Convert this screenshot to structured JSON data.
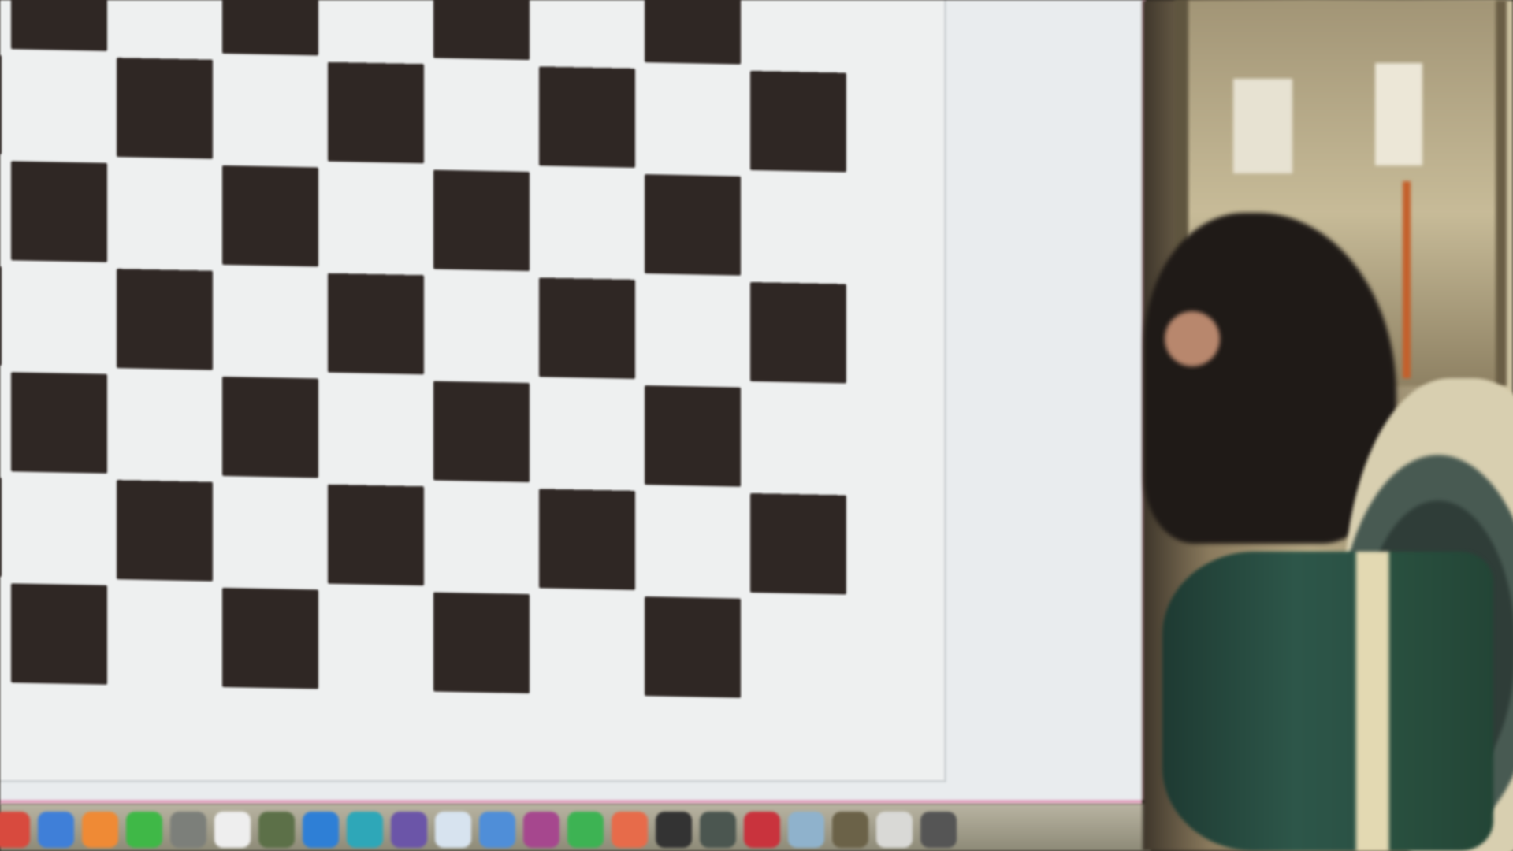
{
  "scene": {
    "description_type": "photo",
    "colors": {
      "board_dark": "#2f2724",
      "board_light": "#eef0f0",
      "screen_bezel_accent": "#e2a9c3"
    }
  },
  "dock": {
    "icons": [
      {
        "name": "app-icon-1",
        "color": "#d84a3e"
      },
      {
        "name": "app-icon-2",
        "color": "#3f7fd8"
      },
      {
        "name": "app-icon-3",
        "color": "#ef8a35"
      },
      {
        "name": "app-icon-4",
        "color": "#3fb847"
      },
      {
        "name": "app-icon-5",
        "color": "#7c7f7a"
      },
      {
        "name": "app-icon-6",
        "color": "#eeeeee"
      },
      {
        "name": "app-icon-7",
        "color": "#5c7048"
      },
      {
        "name": "app-icon-8",
        "color": "#2e7fd6"
      },
      {
        "name": "app-icon-9",
        "color": "#2ea7b8"
      },
      {
        "name": "app-icon-10",
        "color": "#6b55a8"
      },
      {
        "name": "app-icon-11",
        "color": "#d7e3ef"
      },
      {
        "name": "app-icon-12",
        "color": "#4f8ed8"
      },
      {
        "name": "app-icon-13",
        "color": "#a6478e"
      },
      {
        "name": "app-icon-14",
        "color": "#3db353"
      },
      {
        "name": "app-icon-15",
        "color": "#e76b4a"
      },
      {
        "name": "app-icon-16",
        "color": "#333333"
      },
      {
        "name": "app-icon-17",
        "color": "#4b5650"
      },
      {
        "name": "app-icon-18",
        "color": "#c9333d"
      },
      {
        "name": "app-icon-19",
        "color": "#8fb2cc"
      },
      {
        "name": "app-icon-20",
        "color": "#6b6248"
      },
      {
        "name": "app-icon-21",
        "color": "#d9d9d6"
      },
      {
        "name": "app-icon-22",
        "color": "#555555"
      }
    ]
  }
}
